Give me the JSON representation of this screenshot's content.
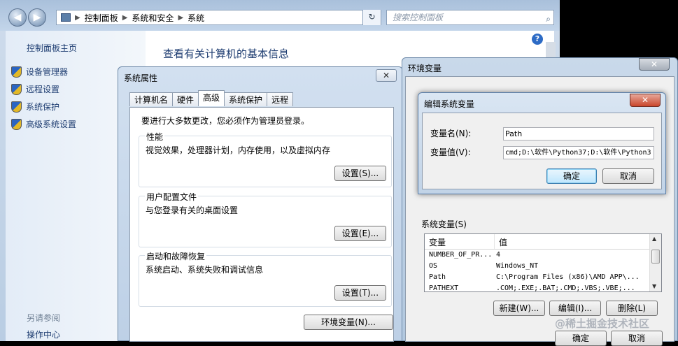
{
  "control_panel": {
    "breadcrumb": [
      "控制面板",
      "系统和安全",
      "系统"
    ],
    "search_placeholder": "搜索控制面板",
    "sidebar_home": "控制面板主页",
    "sidebar_items": [
      "设备管理器",
      "远程设置",
      "系统保护",
      "高级系统设置"
    ],
    "see_also_title": "另请参阅",
    "see_also_link": "操作中心",
    "main_title": "查看有关计算机的基本信息",
    "help": "?"
  },
  "system_properties": {
    "title": "系统属性",
    "tabs": [
      "计算机名",
      "硬件",
      "高级",
      "系统保护",
      "远程"
    ],
    "active_tab": "高级",
    "intro": "要进行大多数更改，您必须作为管理员登录。",
    "groups": [
      {
        "title": "性能",
        "desc": "视觉效果，处理器计划，内存使用，以及虚拟内存",
        "button": "设置(S)..."
      },
      {
        "title": "用户配置文件",
        "desc": "与您登录有关的桌面设置",
        "button": "设置(E)..."
      },
      {
        "title": "启动和故障恢复",
        "desc": "系统启动、系统失败和调试信息",
        "button": "设置(T)..."
      }
    ],
    "env_button": "环境变量(N)..."
  },
  "environment_variables": {
    "title": "环境变量",
    "system_vars_label": "系统变量(S)",
    "columns": [
      "变量",
      "值"
    ],
    "rows": [
      {
        "name": "NUMBER_OF_PR...",
        "value": "4"
      },
      {
        "name": "OS",
        "value": "Windows_NT"
      },
      {
        "name": "Path",
        "value": "C:\\Program Files (x86)\\AMD APP\\..."
      },
      {
        "name": "PATHEXT",
        "value": ".COM;.EXE;.BAT;.CMD;.VBS;.VBE;..."
      }
    ],
    "buttons": [
      "新建(W)...",
      "编辑(I)...",
      "删除(L)"
    ],
    "ok": "确定",
    "cancel": "取消"
  },
  "edit_system_variable": {
    "title": "编辑系统变量",
    "name_label": "变量名(N):",
    "name_value": "Path",
    "value_label": "变量值(V):",
    "value_value": "cmd;D:\\软件\\Python37;D:\\软件\\Python3",
    "ok": "确定",
    "cancel": "取消"
  },
  "watermark": "@稀土掘金技术社区",
  "colors": {
    "link": "#1e3d71",
    "close_red": "#c9462b",
    "default_button": "#3c7fb1"
  }
}
